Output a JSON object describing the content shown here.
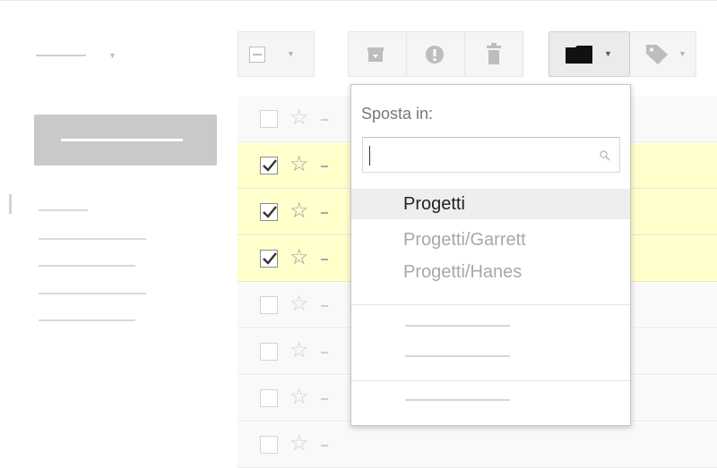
{
  "move_menu": {
    "title": "Sposta in:",
    "search": {
      "value": "",
      "placeholder": ""
    },
    "labels": [
      {
        "label": "Progetti",
        "highlighted": true
      },
      {
        "label": "Progetti/Garrett",
        "highlighted": false
      },
      {
        "label": "Progetti/Hanes",
        "highlighted": false
      }
    ]
  },
  "toolbar": {
    "buttons": [
      "select-all",
      "archive",
      "report-spam",
      "delete",
      "move-to",
      "labels"
    ],
    "active": "move-to"
  },
  "icons": {
    "select": "checkbox-dash-icon",
    "archive": "archive-box-icon",
    "spam": "exclamation-circle-icon",
    "delete": "trash-icon",
    "move": "folder-icon",
    "labels": "tag-icon",
    "search": "magnifier-icon",
    "star": "star-outline-icon"
  },
  "rows": [
    {
      "checked": false,
      "starred": false
    },
    {
      "checked": true,
      "starred": false
    },
    {
      "checked": true,
      "starred": false
    },
    {
      "checked": true,
      "starred": false
    },
    {
      "checked": false,
      "starred": false
    },
    {
      "checked": false,
      "starred": false
    },
    {
      "checked": false,
      "starred": false
    },
    {
      "checked": false,
      "starred": false
    }
  ],
  "colors": {
    "selected_row": "#ffffcc",
    "menu_highlight": "#eeeeee"
  }
}
